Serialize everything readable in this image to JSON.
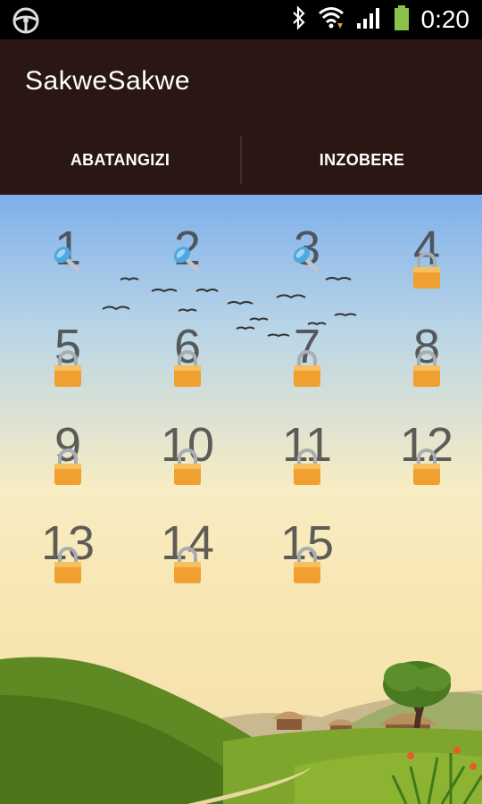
{
  "status_bar": {
    "time": "0:20",
    "icons": [
      "steering-wheel-icon",
      "bluetooth-icon",
      "wifi-icon",
      "signal-icon",
      "battery-icon"
    ]
  },
  "app": {
    "title": "SakweSakwe"
  },
  "tabs": [
    {
      "label": "ABATANGIZI"
    },
    {
      "label": "INZOBERE"
    }
  ],
  "levels": [
    {
      "number": "1",
      "state": "unlocked",
      "icon": "key-icon"
    },
    {
      "number": "2",
      "state": "unlocked",
      "icon": "key-icon"
    },
    {
      "number": "3",
      "state": "unlocked",
      "icon": "key-icon"
    },
    {
      "number": "4",
      "state": "locked",
      "icon": "padlock-icon"
    },
    {
      "number": "5",
      "state": "locked",
      "icon": "padlock-icon"
    },
    {
      "number": "6",
      "state": "locked",
      "icon": "padlock-icon"
    },
    {
      "number": "7",
      "state": "locked",
      "icon": "padlock-icon"
    },
    {
      "number": "8",
      "state": "locked",
      "icon": "padlock-icon"
    },
    {
      "number": "9",
      "state": "locked",
      "icon": "padlock-icon"
    },
    {
      "number": "10",
      "state": "locked",
      "icon": "padlock-icon"
    },
    {
      "number": "11",
      "state": "locked",
      "icon": "padlock-icon"
    },
    {
      "number": "12",
      "state": "locked",
      "icon": "padlock-icon"
    },
    {
      "number": "13",
      "state": "locked",
      "icon": "padlock-icon"
    },
    {
      "number": "14",
      "state": "locked",
      "icon": "padlock-icon"
    },
    {
      "number": "15",
      "state": "locked",
      "icon": "padlock-icon"
    }
  ],
  "colors": {
    "appbar": "#2a1714",
    "statusbar": "#000000",
    "lock": "#f0a030",
    "key": "#4fa8e0"
  }
}
